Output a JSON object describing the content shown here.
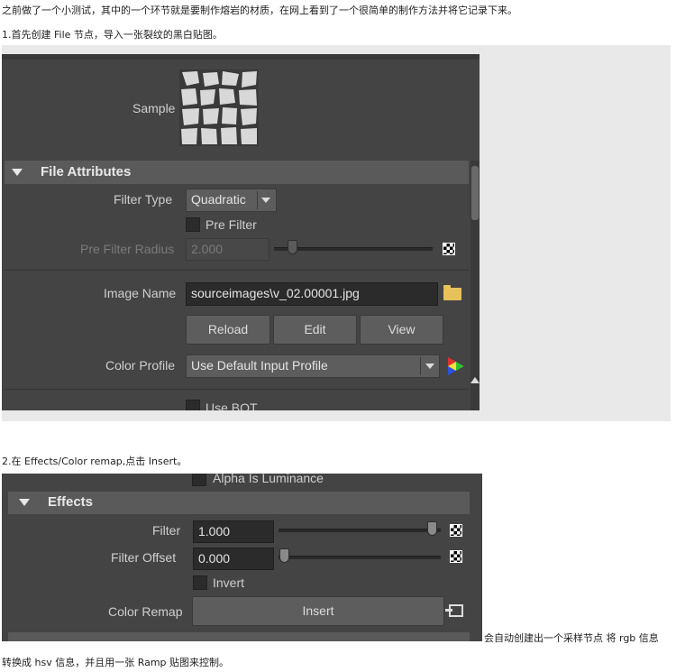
{
  "intro": "之前做了一个小测试，其中的一个环节就是要制作熔岩的材质，在网上看到了一个很简单的制作方法并将它记录下来。",
  "step1": "1.首先创建  File  节点，导入一张裂纹的黑白贴图。",
  "step2": "2.在 Effects/Color remap,点击 Insert。",
  "trailing_text": "会自动创建出一个采样节点 将 rgb 信息",
  "final_text": "转换成 hsv 信息，并且用一张 Ramp 贴图来控制。",
  "panel1": {
    "sample_label": "Sample",
    "section_title": "File Attributes",
    "filter_type_label": "Filter Type",
    "filter_type_value": "Quadratic",
    "pre_filter_label": "Pre Filter",
    "pre_filter_radius_label": "Pre Filter Radius",
    "pre_filter_radius_value": "2.000",
    "image_name_label": "Image Name",
    "image_name_value": "sourceimages\\v_02.00001.jpg",
    "reload_label": "Reload",
    "edit_label": "Edit",
    "view_label": "View",
    "color_profile_label": "Color Profile",
    "color_profile_value": "Use Default Input Profile",
    "use_bot_label": "Use BOT"
  },
  "panel2": {
    "alpha_label": "Alpha Is Luminance",
    "section_title": "Effects",
    "filter_label": "Filter",
    "filter_value": "1.000",
    "filter_offset_label": "Filter Offset",
    "filter_offset_value": "0.000",
    "invert_label": "Invert",
    "color_remap_label": "Color Remap",
    "insert_label": "Insert"
  }
}
